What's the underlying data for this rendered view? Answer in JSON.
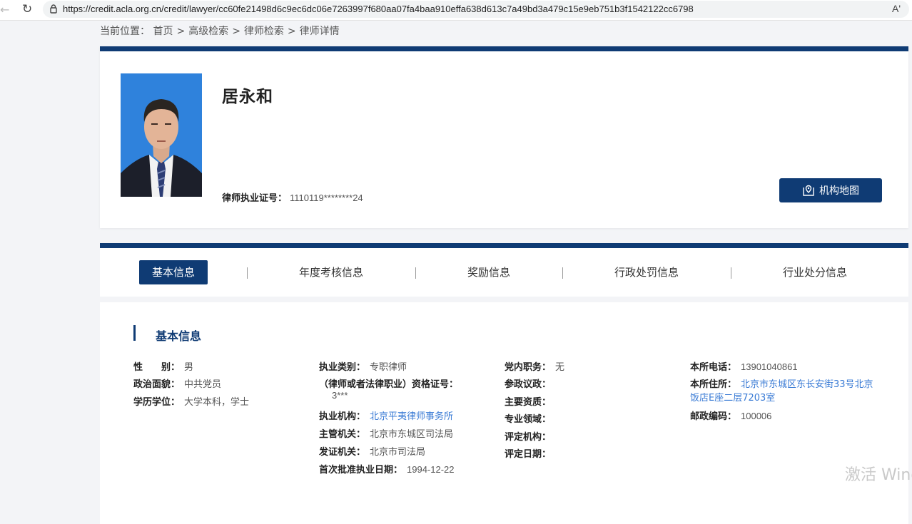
{
  "browser": {
    "url": "https://credit.acla.org.cn/credit/lawyer/cc60fe21498d6c9ec6dc06e7263997f680aa07fa4baa910effa638d613c7a49bd3a479c15e9eb751b3f1542122cc6798",
    "read_aloud_label": "Aʹ"
  },
  "breadcrumb": {
    "prefix": "当前位置：",
    "items": [
      "首页",
      "高级检索",
      "律师检索",
      "律师详情"
    ],
    "separator": ">"
  },
  "profile": {
    "name": "居永和",
    "license_label": "律师执业证号：",
    "license_value": "1110119********24",
    "map_button_label": "机构地图"
  },
  "tabs": [
    {
      "label": "基本信息",
      "active": true
    },
    {
      "label": "年度考核信息",
      "active": false
    },
    {
      "label": "奖励信息",
      "active": false
    },
    {
      "label": "行政处罚信息",
      "active": false
    },
    {
      "label": "行业处分信息",
      "active": false
    }
  ],
  "basic_info": {
    "title": "基本信息",
    "col1": [
      {
        "label": "性　　别：",
        "value": "男"
      },
      {
        "label": "政治面貌：",
        "value": "中共党员"
      },
      {
        "label": "学历学位：",
        "value": "大学本科，学士"
      }
    ],
    "col2": {
      "practice_type_label": "执业类别：",
      "practice_type_value": "专职律师",
      "qualification_label": "（律师或者法律职业）资格证号：",
      "qualification_value": "3***",
      "firm_label": "执业机构：",
      "firm_value": "北京平夷律师事务所",
      "authority_label": "主管机关：",
      "authority_value": "北京市东城区司法局",
      "issuer_label": "发证机关：",
      "issuer_value": "北京市司法局",
      "first_date_label": "首次批准执业日期：",
      "first_date_value": "1994-12-22"
    },
    "col3": [
      {
        "label": "党内职务：",
        "value": "无"
      },
      {
        "label": "参政议政：",
        "value": ""
      },
      {
        "label": "主要资质：",
        "value": ""
      },
      {
        "label": "专业领域：",
        "value": ""
      },
      {
        "label": "评定机构：",
        "value": ""
      },
      {
        "label": "评定日期：",
        "value": ""
      }
    ],
    "col4": {
      "phone_label": "本所电话：",
      "phone_value": "13901040861",
      "address_label": "本所住所：",
      "address_line1": "北京市东城区东长安街33号北京",
      "address_line2": "饭店E座二层7203室",
      "postcode_label": "邮政编码：",
      "postcode_value": "100006"
    }
  },
  "watermark": "激活 Windo",
  "colors": {
    "brand_navy": "#0f3b74",
    "link_blue": "#3a7bd5",
    "page_bg": "#f3f4f7"
  }
}
